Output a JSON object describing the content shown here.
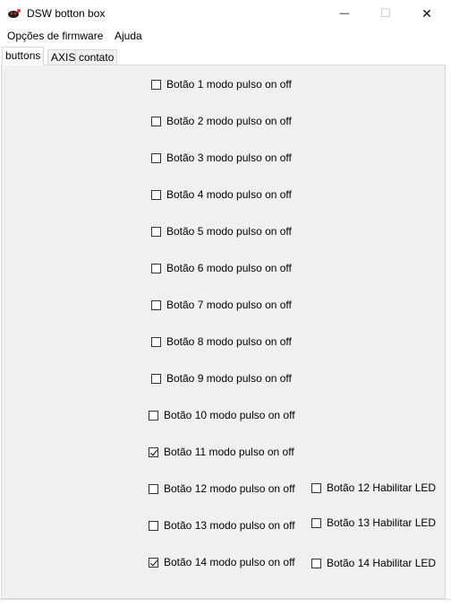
{
  "window": {
    "title": "DSW botton box",
    "min_glyph": "—",
    "max_glyph": "☐",
    "close_glyph": "✕"
  },
  "menu": {
    "items": [
      "Opções de firmware",
      "Ajuda"
    ]
  },
  "tabs": [
    {
      "label": "buttons",
      "active": true
    },
    {
      "label": "AXIS",
      "active": false
    },
    {
      "label": "contato",
      "active": false
    }
  ],
  "buttons_tab": {
    "modes": [
      {
        "label": "Botão 1 modo pulso on off",
        "checked": false
      },
      {
        "label": "Botão 2 modo pulso on off",
        "checked": false
      },
      {
        "label": "Botão 3 modo pulso on off",
        "checked": false
      },
      {
        "label": "Botão 4 modo pulso on off",
        "checked": false
      },
      {
        "label": "Botão 5 modo pulso on off",
        "checked": false
      },
      {
        "label": "Botão 6 modo pulso on off",
        "checked": false
      },
      {
        "label": "Botão 7 modo pulso on off",
        "checked": false
      },
      {
        "label": "Botão 8 modo pulso on off",
        "checked": false
      },
      {
        "label": "Botão 9 modo pulso on off",
        "checked": false
      },
      {
        "label": "Botão 10 modo pulso on off",
        "checked": false
      },
      {
        "label": "Botão 11 modo pulso on off",
        "checked": true
      },
      {
        "label": "Botão 12 modo pulso on off",
        "checked": false
      },
      {
        "label": "Botão 13 modo pulso on off",
        "checked": false
      },
      {
        "label": "Botão 14 modo pulso on off",
        "checked": true
      }
    ],
    "leds": [
      {
        "label": "Botão 12 Habilitar LED",
        "checked": false
      },
      {
        "label": "Botão 13 Habilitar LED",
        "checked": false
      },
      {
        "label": "Botão 14 Habilitar LED",
        "checked": false
      }
    ]
  }
}
